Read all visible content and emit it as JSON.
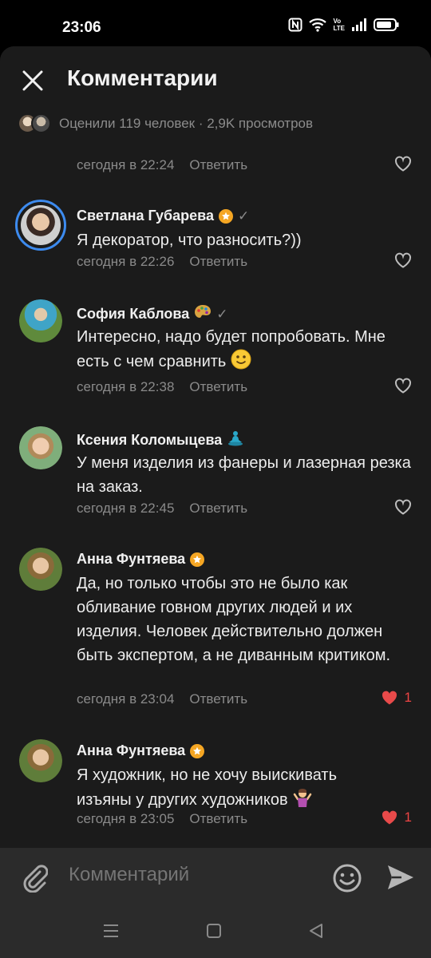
{
  "status_bar": {
    "time": "23:06",
    "icons": [
      "nfc-icon",
      "wifi-icon",
      "volte-icon",
      "signal-icon",
      "battery-icon"
    ],
    "volte_top": "Vo",
    "volte_bottom": "LTE"
  },
  "header": {
    "title": "Комментарии",
    "likes_summary": "Оценили 119 человек · 2,9K просмотров"
  },
  "partial_comment": {
    "time": "сегодня в 22:24",
    "reply_label": "Ответить"
  },
  "comments": [
    {
      "author": "Светлана Губарева",
      "badge": "star-badge",
      "verified": "✓",
      "text": "Я декоратор, что разносить?))",
      "time": "сегодня в 22:26",
      "reply_label": "Ответить",
      "likes": ""
    },
    {
      "author": "София Каблова",
      "badge": "palette-emoji",
      "verified": "✓",
      "text": "Интересно,  надо будет попробовать. Мне есть с чем сравнить",
      "time": "сегодня в 22:38",
      "reply_label": "Ответить",
      "likes": ""
    },
    {
      "author": "Ксения Коломыцева",
      "badge": "person-in-lotus-emoji",
      "verified": "",
      "text": "У меня изделия из фанеры и лазерная резка на заказ.",
      "time": "сегодня в 22:45",
      "reply_label": "Ответить",
      "likes": ""
    },
    {
      "author": "Анна Фунтяева",
      "badge": "star-badge",
      "verified": "",
      "text": "Да, но только чтобы это не было как обливание говном других людей и их изделия. Человек действительно должен быть экспертом, а не диванным критиком.",
      "time": "сегодня в 23:04",
      "reply_label": "Ответить",
      "likes": "1"
    },
    {
      "author": "Анна Фунтяева",
      "badge": "star-badge",
      "verified": "",
      "text": "Я художник, но не хочу выискивать изъяны у других художников",
      "time": "сегодня в 23:05",
      "reply_label": "Ответить",
      "likes": "1"
    }
  ],
  "input_bar": {
    "placeholder": "Комментарий"
  },
  "colors": {
    "background": "#1b1b1b",
    "accent_blue": "#3d8bef",
    "like_red": "#e84a4a",
    "badge_orange": "#f5a623",
    "meta_gray": "#8a8a8a"
  }
}
